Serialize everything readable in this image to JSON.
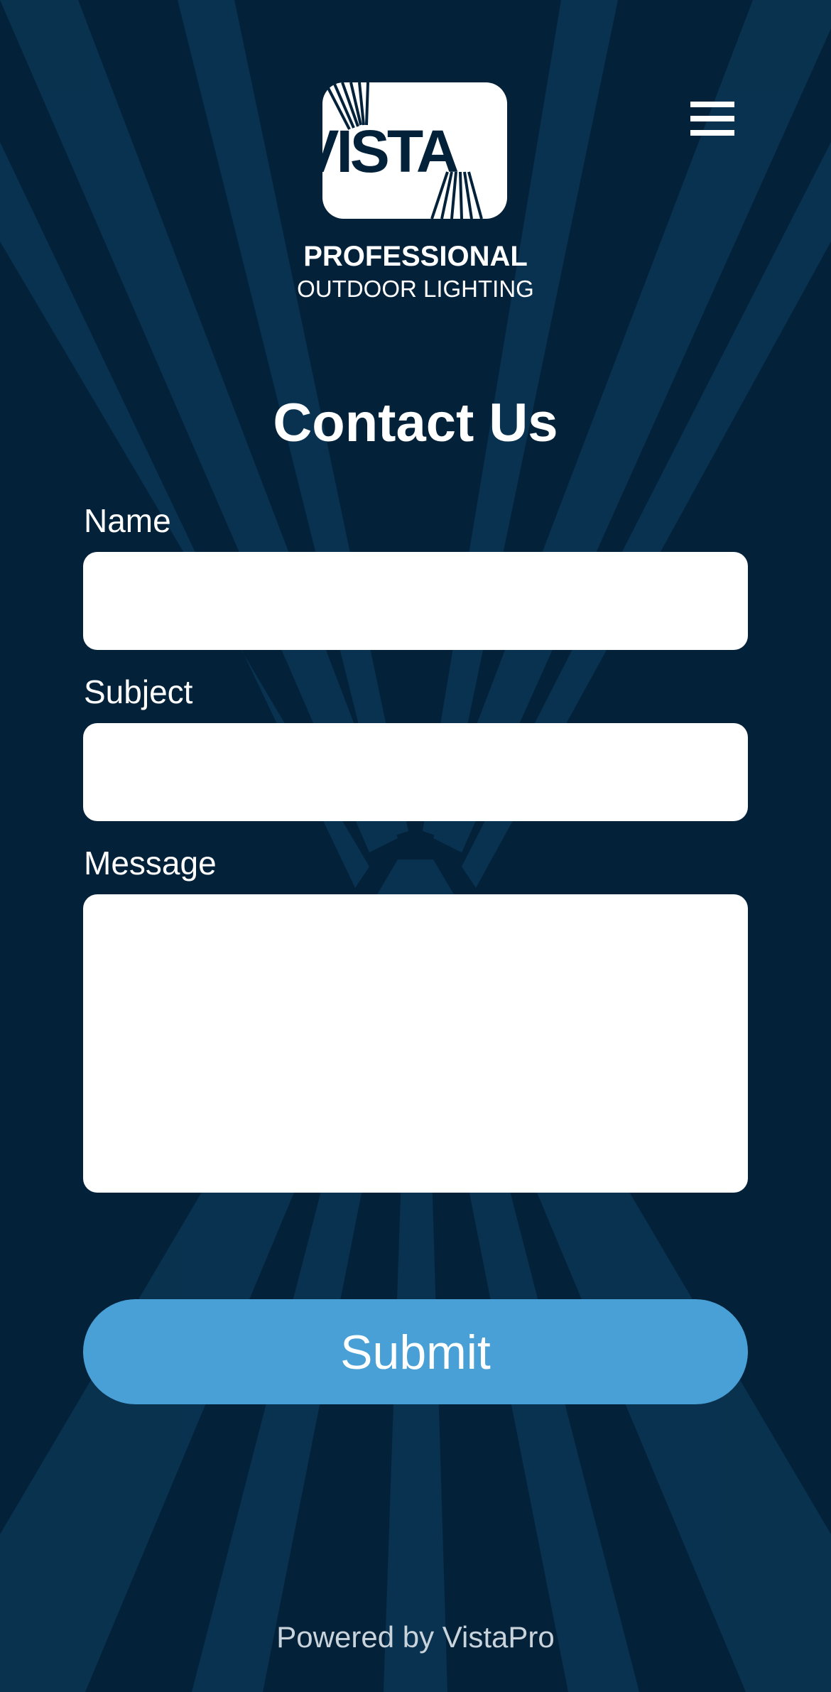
{
  "brand": {
    "logo_word": "VISTA",
    "logo_line1": "PROFESSIONAL",
    "logo_line2": "OUTDOOR LIGHTING"
  },
  "header": {
    "menu_icon": "hamburger-menu-icon"
  },
  "page": {
    "title": "Contact Us"
  },
  "form": {
    "fields": [
      {
        "label": "Name",
        "value": "",
        "placeholder": ""
      },
      {
        "label": "Subject",
        "value": "",
        "placeholder": ""
      },
      {
        "label": "Message",
        "value": "",
        "placeholder": ""
      }
    ],
    "submit_label": "Submit"
  },
  "footer": {
    "text": "Powered by VistaPro"
  },
  "colors": {
    "background": "#03223a",
    "rays": "#0a3553",
    "accent": "#48a0d6",
    "input_background": "#ffffff"
  }
}
